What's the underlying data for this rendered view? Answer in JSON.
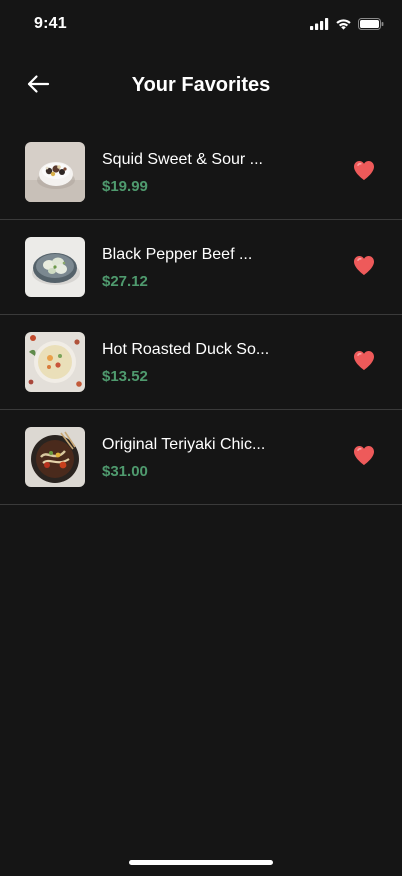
{
  "status_bar": {
    "time": "9:41"
  },
  "header": {
    "title": "Your Favorites",
    "back_icon": "arrow-left-icon"
  },
  "favorites": [
    {
      "name": "Squid Sweet & Sour ...",
      "price": "$19.99"
    },
    {
      "name": "Black Pepper Beef ...",
      "price": "$27.12"
    },
    {
      "name": "Hot Roasted Duck So...",
      "price": "$13.52"
    },
    {
      "name": "Original Teriyaki Chic...",
      "price": "$31.00"
    }
  ],
  "colors": {
    "background": "#151515",
    "price": "#4f9a6e",
    "heart": "#ee5a5a",
    "divider": "#3a3a3a"
  }
}
